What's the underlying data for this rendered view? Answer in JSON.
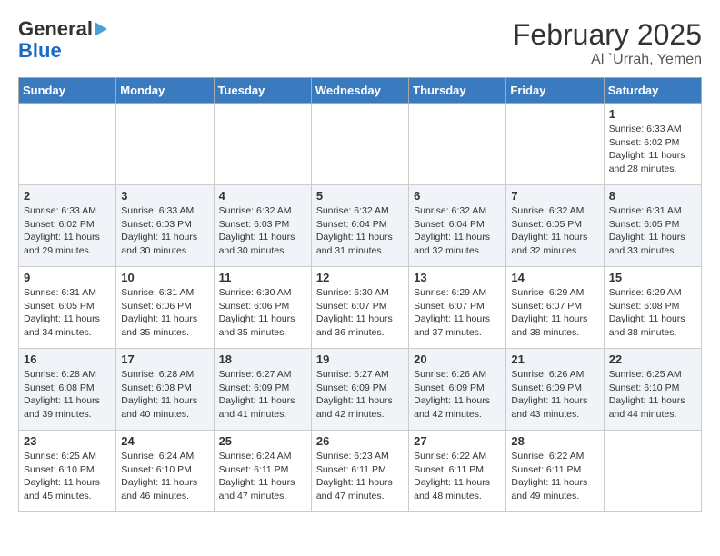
{
  "header": {
    "logo_general": "General",
    "logo_blue": "Blue",
    "month": "February 2025",
    "location": "Al `Urrah, Yemen"
  },
  "days_of_week": [
    "Sunday",
    "Monday",
    "Tuesday",
    "Wednesday",
    "Thursday",
    "Friday",
    "Saturday"
  ],
  "weeks": [
    [
      {
        "day": "",
        "info": ""
      },
      {
        "day": "",
        "info": ""
      },
      {
        "day": "",
        "info": ""
      },
      {
        "day": "",
        "info": ""
      },
      {
        "day": "",
        "info": ""
      },
      {
        "day": "",
        "info": ""
      },
      {
        "day": "1",
        "info": "Sunrise: 6:33 AM\nSunset: 6:02 PM\nDaylight: 11 hours and 28 minutes."
      }
    ],
    [
      {
        "day": "2",
        "info": "Sunrise: 6:33 AM\nSunset: 6:02 PM\nDaylight: 11 hours and 29 minutes."
      },
      {
        "day": "3",
        "info": "Sunrise: 6:33 AM\nSunset: 6:03 PM\nDaylight: 11 hours and 30 minutes."
      },
      {
        "day": "4",
        "info": "Sunrise: 6:32 AM\nSunset: 6:03 PM\nDaylight: 11 hours and 30 minutes."
      },
      {
        "day": "5",
        "info": "Sunrise: 6:32 AM\nSunset: 6:04 PM\nDaylight: 11 hours and 31 minutes."
      },
      {
        "day": "6",
        "info": "Sunrise: 6:32 AM\nSunset: 6:04 PM\nDaylight: 11 hours and 32 minutes."
      },
      {
        "day": "7",
        "info": "Sunrise: 6:32 AM\nSunset: 6:05 PM\nDaylight: 11 hours and 32 minutes."
      },
      {
        "day": "8",
        "info": "Sunrise: 6:31 AM\nSunset: 6:05 PM\nDaylight: 11 hours and 33 minutes."
      }
    ],
    [
      {
        "day": "9",
        "info": "Sunrise: 6:31 AM\nSunset: 6:05 PM\nDaylight: 11 hours and 34 minutes."
      },
      {
        "day": "10",
        "info": "Sunrise: 6:31 AM\nSunset: 6:06 PM\nDaylight: 11 hours and 35 minutes."
      },
      {
        "day": "11",
        "info": "Sunrise: 6:30 AM\nSunset: 6:06 PM\nDaylight: 11 hours and 35 minutes."
      },
      {
        "day": "12",
        "info": "Sunrise: 6:30 AM\nSunset: 6:07 PM\nDaylight: 11 hours and 36 minutes."
      },
      {
        "day": "13",
        "info": "Sunrise: 6:29 AM\nSunset: 6:07 PM\nDaylight: 11 hours and 37 minutes."
      },
      {
        "day": "14",
        "info": "Sunrise: 6:29 AM\nSunset: 6:07 PM\nDaylight: 11 hours and 38 minutes."
      },
      {
        "day": "15",
        "info": "Sunrise: 6:29 AM\nSunset: 6:08 PM\nDaylight: 11 hours and 38 minutes."
      }
    ],
    [
      {
        "day": "16",
        "info": "Sunrise: 6:28 AM\nSunset: 6:08 PM\nDaylight: 11 hours and 39 minutes."
      },
      {
        "day": "17",
        "info": "Sunrise: 6:28 AM\nSunset: 6:08 PM\nDaylight: 11 hours and 40 minutes."
      },
      {
        "day": "18",
        "info": "Sunrise: 6:27 AM\nSunset: 6:09 PM\nDaylight: 11 hours and 41 minutes."
      },
      {
        "day": "19",
        "info": "Sunrise: 6:27 AM\nSunset: 6:09 PM\nDaylight: 11 hours and 42 minutes."
      },
      {
        "day": "20",
        "info": "Sunrise: 6:26 AM\nSunset: 6:09 PM\nDaylight: 11 hours and 42 minutes."
      },
      {
        "day": "21",
        "info": "Sunrise: 6:26 AM\nSunset: 6:09 PM\nDaylight: 11 hours and 43 minutes."
      },
      {
        "day": "22",
        "info": "Sunrise: 6:25 AM\nSunset: 6:10 PM\nDaylight: 11 hours and 44 minutes."
      }
    ],
    [
      {
        "day": "23",
        "info": "Sunrise: 6:25 AM\nSunset: 6:10 PM\nDaylight: 11 hours and 45 minutes."
      },
      {
        "day": "24",
        "info": "Sunrise: 6:24 AM\nSunset: 6:10 PM\nDaylight: 11 hours and 46 minutes."
      },
      {
        "day": "25",
        "info": "Sunrise: 6:24 AM\nSunset: 6:11 PM\nDaylight: 11 hours and 47 minutes."
      },
      {
        "day": "26",
        "info": "Sunrise: 6:23 AM\nSunset: 6:11 PM\nDaylight: 11 hours and 47 minutes."
      },
      {
        "day": "27",
        "info": "Sunrise: 6:22 AM\nSunset: 6:11 PM\nDaylight: 11 hours and 48 minutes."
      },
      {
        "day": "28",
        "info": "Sunrise: 6:22 AM\nSunset: 6:11 PM\nDaylight: 11 hours and 49 minutes."
      },
      {
        "day": "",
        "info": ""
      }
    ]
  ]
}
